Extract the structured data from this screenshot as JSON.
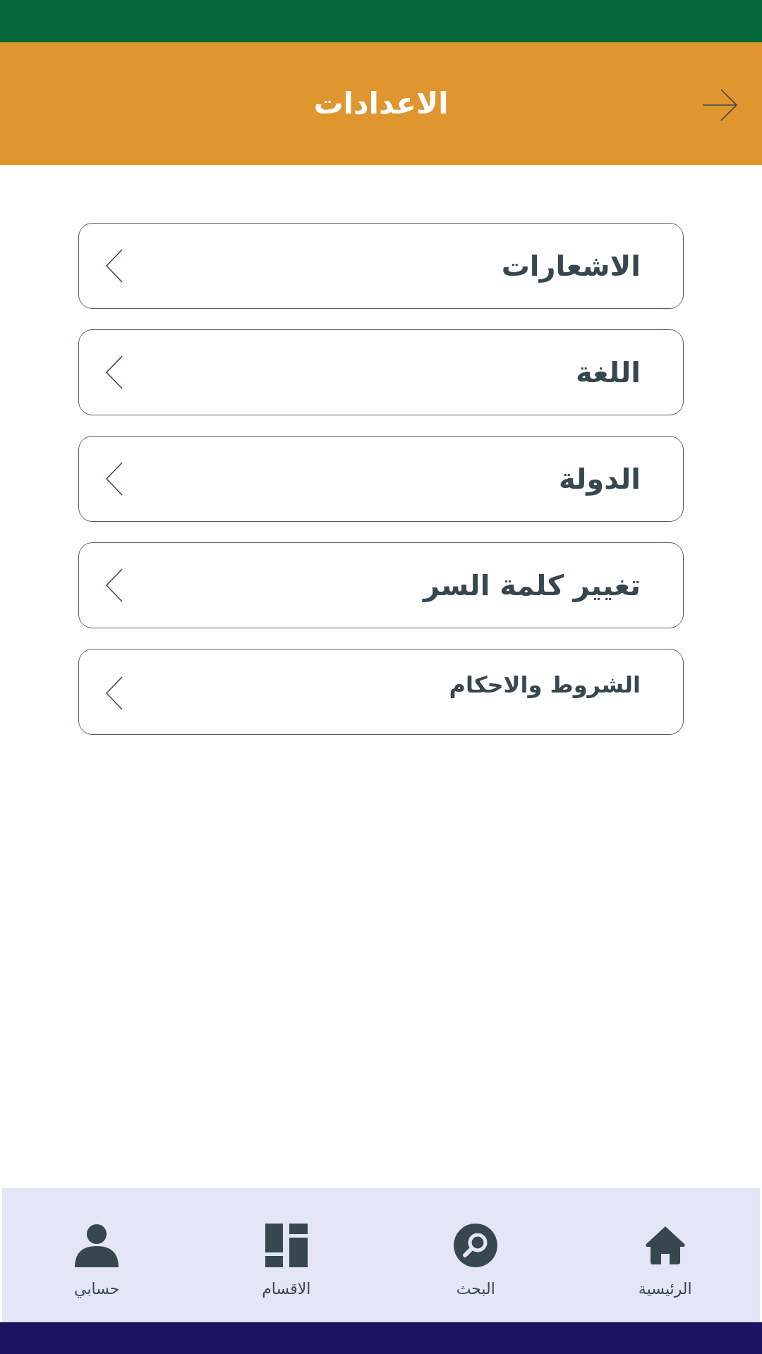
{
  "header": {
    "title": "الاعدادات"
  },
  "settings_items": [
    {
      "label": "الاشعارات"
    },
    {
      "label": "اللغة"
    },
    {
      "label": "الدولة"
    },
    {
      "label": "تغيير كلمة السر"
    },
    {
      "label": "الشروط والاحكام"
    }
  ],
  "bottom_nav": [
    {
      "label": "الرئيسية",
      "kind": "home"
    },
    {
      "label": "البحث",
      "kind": "search"
    },
    {
      "label": "الاقسام",
      "kind": "categories"
    },
    {
      "label": "حسابي",
      "kind": "account"
    }
  ]
}
